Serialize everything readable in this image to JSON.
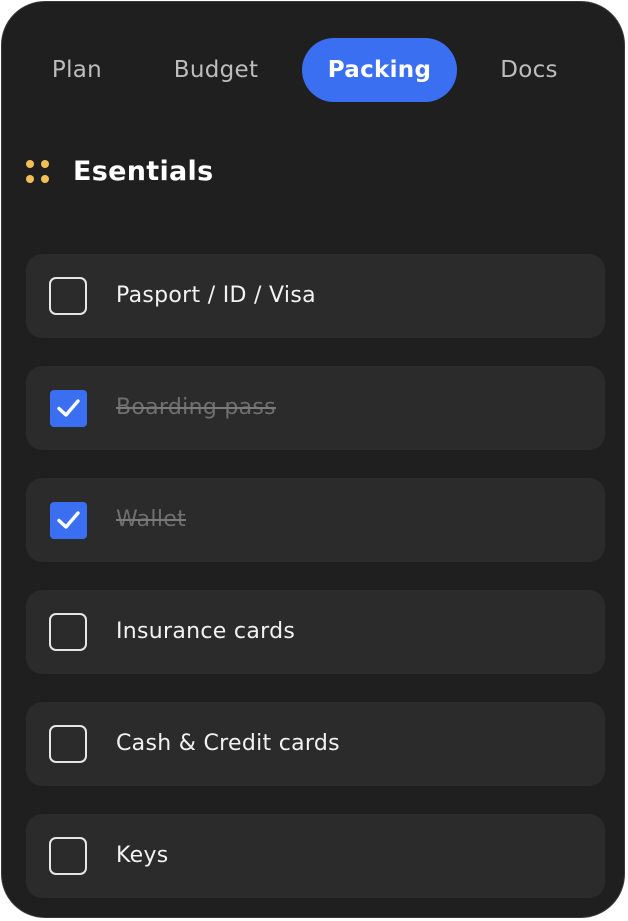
{
  "tabs": [
    {
      "label": "Plan",
      "active": false
    },
    {
      "label": "Budget",
      "active": false
    },
    {
      "label": "Packing",
      "active": true
    },
    {
      "label": "Docs",
      "active": false
    }
  ],
  "section": {
    "title": "Esentials",
    "handle_icon": "drag-handle-icon"
  },
  "items": [
    {
      "label": "Pasport / ID / Visa",
      "checked": false
    },
    {
      "label": "Boarding pass",
      "checked": true
    },
    {
      "label": "Wallet",
      "checked": true
    },
    {
      "label": "Insurance cards",
      "checked": false
    },
    {
      "label": "Cash & Credit cards",
      "checked": false
    },
    {
      "label": "Keys",
      "checked": false
    }
  ],
  "colors": {
    "background": "#1f1f1f",
    "item_background": "#2b2b2b",
    "accent": "#3a6ff2",
    "handle": "#f2bf55",
    "text": "#f2f2f2",
    "muted_text": "#6f6f6f",
    "inactive_tab": "#bdbdbd"
  }
}
